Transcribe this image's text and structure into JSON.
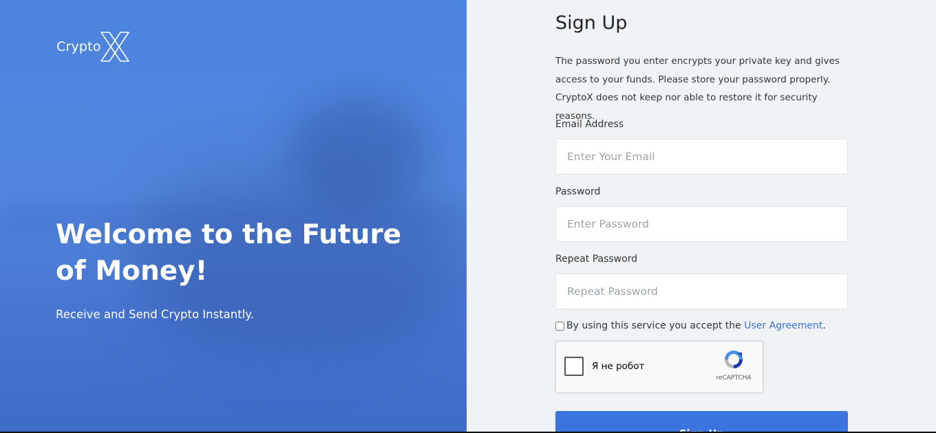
{
  "brand": {
    "name": "Crypto",
    "mark": "X"
  },
  "hero": {
    "title": "Welcome to the Future of Money!",
    "subtitle": "Receive and Send Crypto Instantly."
  },
  "form": {
    "title": "Sign Up",
    "description": "The password you enter encrypts your private key and gives access to your funds. Please store your password properly. CryptoX does not keep nor able to restore it for security reasons.",
    "email": {
      "label": "Email Address",
      "placeholder": "Enter Your Email",
      "value": ""
    },
    "password": {
      "label": "Password",
      "placeholder": "Enter Password",
      "value": ""
    },
    "repeat_password": {
      "label": "Repeat Password",
      "placeholder": "Repeat Password",
      "value": ""
    },
    "agreement": {
      "text": "By using this service you accept the",
      "link_text": "User Agreement",
      "suffix": ".",
      "checked": false
    },
    "captcha": {
      "label": "Я не робот",
      "brand": "reCAPTCHA"
    },
    "submit_label": "Sign Up"
  },
  "colors": {
    "accent": "#3b74de",
    "link": "#3a72d9",
    "hero_bg": "#4b84df"
  }
}
